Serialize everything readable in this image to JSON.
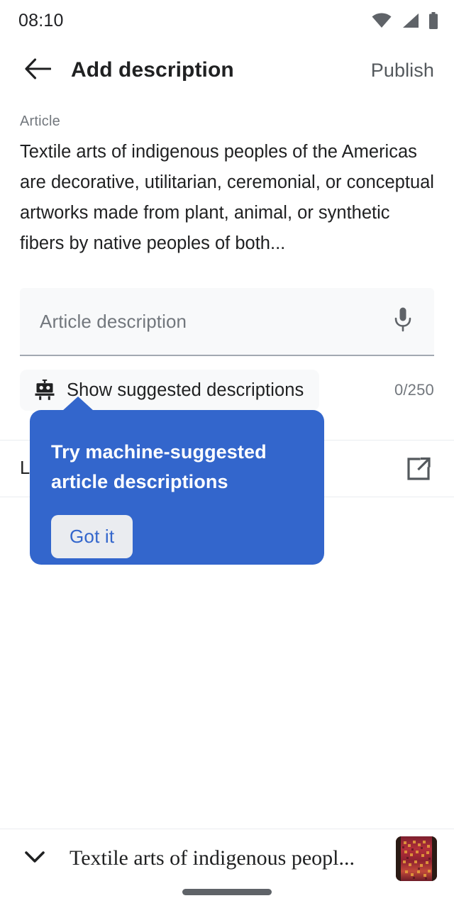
{
  "status_bar": {
    "time": "08:10",
    "icons": [
      "wifi-icon",
      "cellular-signal-icon",
      "battery-icon"
    ]
  },
  "app_bar": {
    "back_icon": "back-arrow-icon",
    "title": "Add description",
    "publish_label": "Publish"
  },
  "article": {
    "label": "Article",
    "extract": "Textile arts of indigenous peoples of the Americas are decorative, utilitarian, ceremonial, or conceptual artworks made from plant, animal, or synthetic fibers by native peoples of both..."
  },
  "description_input": {
    "placeholder": "Article description",
    "value": "",
    "mic_icon": "microphone-icon"
  },
  "suggested": {
    "icon": "robot-icon",
    "label": "Show suggested descriptions",
    "counter": "0/250"
  },
  "learn_more": {
    "label": "Learn more about descriptions",
    "icon": "external-link-icon"
  },
  "tooltip": {
    "text": "Try machine-suggested article descriptions",
    "button_label": "Got it",
    "background": "#3366cc",
    "button_background": "#eaecf0",
    "button_text_color": "#3366cc"
  },
  "bottom_bar": {
    "chevron_icon": "chevron-down-icon",
    "title": "Textile arts of indigenous peopl...",
    "thumbnail": "textile-pattern-thumbnail"
  },
  "colors": {
    "accent": "#3366cc",
    "text_primary": "#202122",
    "text_muted": "#72777d",
    "field_background": "#f8f9fa",
    "divider": "#eaecf0"
  }
}
